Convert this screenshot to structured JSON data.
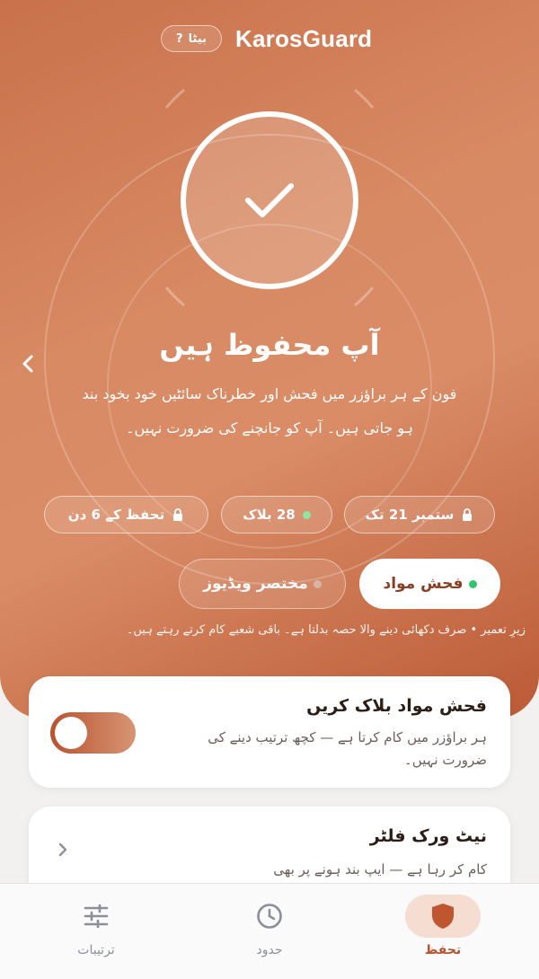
{
  "header": {
    "app_title": "KarosGuard",
    "beta_label": "بیٹا",
    "help_label": "?"
  },
  "status": {
    "title": "آپ محفوظ ہیں",
    "description": "فون کے ہر براؤزر میں فحش اور خطرناک سائٹیں خود بخود بند ہو جاتی ہیں۔ آپ کو جانچنے کی ضرورت نہیں۔"
  },
  "stats": [
    {
      "label": "ستمبر 21 تک",
      "icon": "lock-icon"
    },
    {
      "label": "28 بلاک",
      "icon": "green-dot",
      "dot_color": "#8ee4a0"
    },
    {
      "label": "تحفظ کے 6 دن",
      "icon": "lock-icon"
    }
  ],
  "mode_tabs": [
    {
      "label": "فحش مواد",
      "active": true,
      "dot_color": "#33c46e"
    },
    {
      "label": "مختصر ویڈیوز",
      "active": false,
      "dot_color": "#d9b3a6"
    }
  ],
  "footnote": "زیرِ تعمیر • صرف دکھائی دینے والا حصہ بدلتا ہے۔ باقی شعبے کام کرتے رہتے ہیں۔",
  "cards": [
    {
      "title": "فحش مواد بلاک کریں",
      "subtitle": "ہر براؤزر میں کام کرتا ہے — کچھ ترتیب دینے کی ضرورت نہیں۔",
      "toggle_on": true
    },
    {
      "title": "نیٹ ورک فلٹر",
      "subtitle": "کام کر رہا ہے — ایپ بند ہونے پر بھی"
    }
  ],
  "bottom_nav": [
    {
      "label": "ترتیبات",
      "icon": "sliders-icon",
      "active": false
    },
    {
      "label": "حدود",
      "icon": "clock-icon",
      "active": false
    },
    {
      "label": "تحفظ",
      "icon": "shield-icon",
      "active": true
    }
  ],
  "colors": {
    "accent": "#b8532f",
    "hero_gradient_start": "#c9714b",
    "hero_gradient_end": "#bb5a36",
    "success_dot": "#33c46e"
  }
}
